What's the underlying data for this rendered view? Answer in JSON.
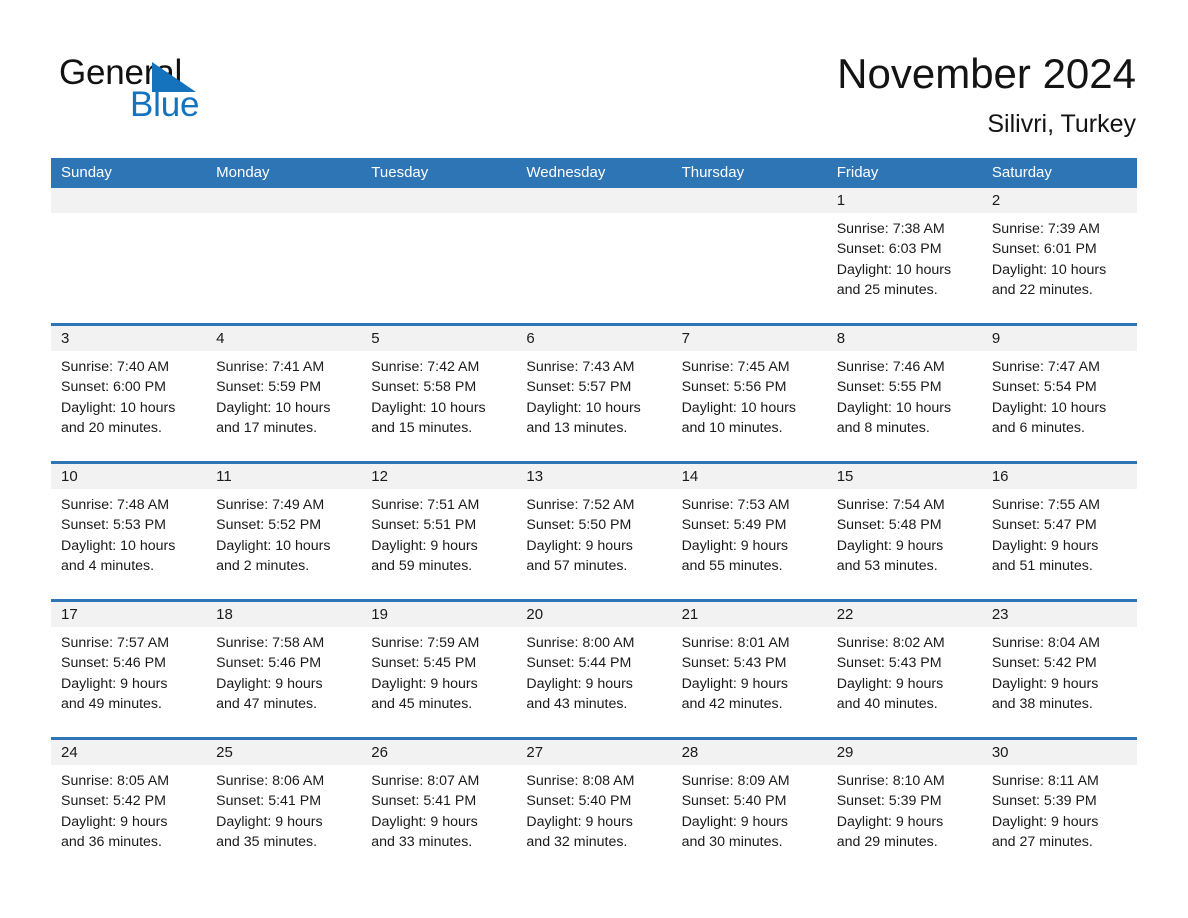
{
  "logo": {
    "word_one": "General",
    "word_two": "Blue",
    "triangle_color": "#1573BE"
  },
  "header": {
    "title": "November 2024",
    "subtitle": "Silivri, Turkey"
  },
  "colors": {
    "header_blue": "#2E75B6",
    "day_number_band": "#F2F2F2",
    "text": "#1a1a1a"
  },
  "weekdays": [
    "Sunday",
    "Monday",
    "Tuesday",
    "Wednesday",
    "Thursday",
    "Friday",
    "Saturday"
  ],
  "weeks": [
    [
      {
        "day": "",
        "sunrise": "",
        "sunset": "",
        "daylight_1": "",
        "daylight_2": ""
      },
      {
        "day": "",
        "sunrise": "",
        "sunset": "",
        "daylight_1": "",
        "daylight_2": ""
      },
      {
        "day": "",
        "sunrise": "",
        "sunset": "",
        "daylight_1": "",
        "daylight_2": ""
      },
      {
        "day": "",
        "sunrise": "",
        "sunset": "",
        "daylight_1": "",
        "daylight_2": ""
      },
      {
        "day": "",
        "sunrise": "",
        "sunset": "",
        "daylight_1": "",
        "daylight_2": ""
      },
      {
        "day": "1",
        "sunrise": "Sunrise: 7:38 AM",
        "sunset": "Sunset: 6:03 PM",
        "daylight_1": "Daylight: 10 hours",
        "daylight_2": "and 25 minutes."
      },
      {
        "day": "2",
        "sunrise": "Sunrise: 7:39 AM",
        "sunset": "Sunset: 6:01 PM",
        "daylight_1": "Daylight: 10 hours",
        "daylight_2": "and 22 minutes."
      }
    ],
    [
      {
        "day": "3",
        "sunrise": "Sunrise: 7:40 AM",
        "sunset": "Sunset: 6:00 PM",
        "daylight_1": "Daylight: 10 hours",
        "daylight_2": "and 20 minutes."
      },
      {
        "day": "4",
        "sunrise": "Sunrise: 7:41 AM",
        "sunset": "Sunset: 5:59 PM",
        "daylight_1": "Daylight: 10 hours",
        "daylight_2": "and 17 minutes."
      },
      {
        "day": "5",
        "sunrise": "Sunrise: 7:42 AM",
        "sunset": "Sunset: 5:58 PM",
        "daylight_1": "Daylight: 10 hours",
        "daylight_2": "and 15 minutes."
      },
      {
        "day": "6",
        "sunrise": "Sunrise: 7:43 AM",
        "sunset": "Sunset: 5:57 PM",
        "daylight_1": "Daylight: 10 hours",
        "daylight_2": "and 13 minutes."
      },
      {
        "day": "7",
        "sunrise": "Sunrise: 7:45 AM",
        "sunset": "Sunset: 5:56 PM",
        "daylight_1": "Daylight: 10 hours",
        "daylight_2": "and 10 minutes."
      },
      {
        "day": "8",
        "sunrise": "Sunrise: 7:46 AM",
        "sunset": "Sunset: 5:55 PM",
        "daylight_1": "Daylight: 10 hours",
        "daylight_2": "and 8 minutes."
      },
      {
        "day": "9",
        "sunrise": "Sunrise: 7:47 AM",
        "sunset": "Sunset: 5:54 PM",
        "daylight_1": "Daylight: 10 hours",
        "daylight_2": "and 6 minutes."
      }
    ],
    [
      {
        "day": "10",
        "sunrise": "Sunrise: 7:48 AM",
        "sunset": "Sunset: 5:53 PM",
        "daylight_1": "Daylight: 10 hours",
        "daylight_2": "and 4 minutes."
      },
      {
        "day": "11",
        "sunrise": "Sunrise: 7:49 AM",
        "sunset": "Sunset: 5:52 PM",
        "daylight_1": "Daylight: 10 hours",
        "daylight_2": "and 2 minutes."
      },
      {
        "day": "12",
        "sunrise": "Sunrise: 7:51 AM",
        "sunset": "Sunset: 5:51 PM",
        "daylight_1": "Daylight: 9 hours",
        "daylight_2": "and 59 minutes."
      },
      {
        "day": "13",
        "sunrise": "Sunrise: 7:52 AM",
        "sunset": "Sunset: 5:50 PM",
        "daylight_1": "Daylight: 9 hours",
        "daylight_2": "and 57 minutes."
      },
      {
        "day": "14",
        "sunrise": "Sunrise: 7:53 AM",
        "sunset": "Sunset: 5:49 PM",
        "daylight_1": "Daylight: 9 hours",
        "daylight_2": "and 55 minutes."
      },
      {
        "day": "15",
        "sunrise": "Sunrise: 7:54 AM",
        "sunset": "Sunset: 5:48 PM",
        "daylight_1": "Daylight: 9 hours",
        "daylight_2": "and 53 minutes."
      },
      {
        "day": "16",
        "sunrise": "Sunrise: 7:55 AM",
        "sunset": "Sunset: 5:47 PM",
        "daylight_1": "Daylight: 9 hours",
        "daylight_2": "and 51 minutes."
      }
    ],
    [
      {
        "day": "17",
        "sunrise": "Sunrise: 7:57 AM",
        "sunset": "Sunset: 5:46 PM",
        "daylight_1": "Daylight: 9 hours",
        "daylight_2": "and 49 minutes."
      },
      {
        "day": "18",
        "sunrise": "Sunrise: 7:58 AM",
        "sunset": "Sunset: 5:46 PM",
        "daylight_1": "Daylight: 9 hours",
        "daylight_2": "and 47 minutes."
      },
      {
        "day": "19",
        "sunrise": "Sunrise: 7:59 AM",
        "sunset": "Sunset: 5:45 PM",
        "daylight_1": "Daylight: 9 hours",
        "daylight_2": "and 45 minutes."
      },
      {
        "day": "20",
        "sunrise": "Sunrise: 8:00 AM",
        "sunset": "Sunset: 5:44 PM",
        "daylight_1": "Daylight: 9 hours",
        "daylight_2": "and 43 minutes."
      },
      {
        "day": "21",
        "sunrise": "Sunrise: 8:01 AM",
        "sunset": "Sunset: 5:43 PM",
        "daylight_1": "Daylight: 9 hours",
        "daylight_2": "and 42 minutes."
      },
      {
        "day": "22",
        "sunrise": "Sunrise: 8:02 AM",
        "sunset": "Sunset: 5:43 PM",
        "daylight_1": "Daylight: 9 hours",
        "daylight_2": "and 40 minutes."
      },
      {
        "day": "23",
        "sunrise": "Sunrise: 8:04 AM",
        "sunset": "Sunset: 5:42 PM",
        "daylight_1": "Daylight: 9 hours",
        "daylight_2": "and 38 minutes."
      }
    ],
    [
      {
        "day": "24",
        "sunrise": "Sunrise: 8:05 AM",
        "sunset": "Sunset: 5:42 PM",
        "daylight_1": "Daylight: 9 hours",
        "daylight_2": "and 36 minutes."
      },
      {
        "day": "25",
        "sunrise": "Sunrise: 8:06 AM",
        "sunset": "Sunset: 5:41 PM",
        "daylight_1": "Daylight: 9 hours",
        "daylight_2": "and 35 minutes."
      },
      {
        "day": "26",
        "sunrise": "Sunrise: 8:07 AM",
        "sunset": "Sunset: 5:41 PM",
        "daylight_1": "Daylight: 9 hours",
        "daylight_2": "and 33 minutes."
      },
      {
        "day": "27",
        "sunrise": "Sunrise: 8:08 AM",
        "sunset": "Sunset: 5:40 PM",
        "daylight_1": "Daylight: 9 hours",
        "daylight_2": "and 32 minutes."
      },
      {
        "day": "28",
        "sunrise": "Sunrise: 8:09 AM",
        "sunset": "Sunset: 5:40 PM",
        "daylight_1": "Daylight: 9 hours",
        "daylight_2": "and 30 minutes."
      },
      {
        "day": "29",
        "sunrise": "Sunrise: 8:10 AM",
        "sunset": "Sunset: 5:39 PM",
        "daylight_1": "Daylight: 9 hours",
        "daylight_2": "and 29 minutes."
      },
      {
        "day": "30",
        "sunrise": "Sunrise: 8:11 AM",
        "sunset": "Sunset: 5:39 PM",
        "daylight_1": "Daylight: 9 hours",
        "daylight_2": "and 27 minutes."
      }
    ]
  ]
}
